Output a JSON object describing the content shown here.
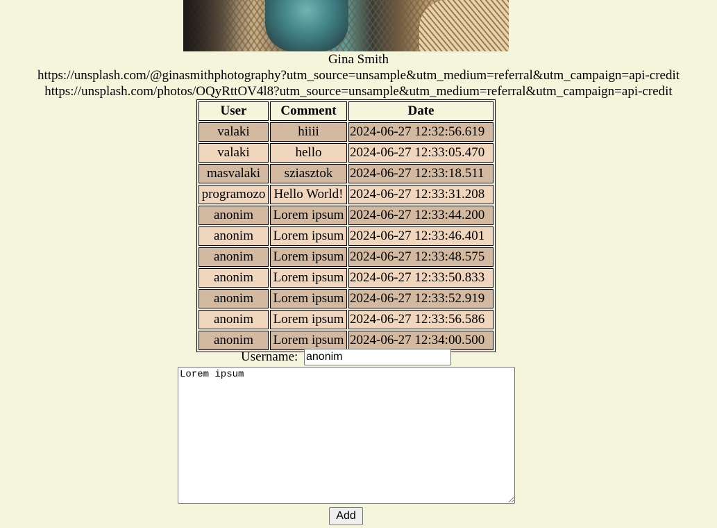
{
  "photo": {
    "alt": "photo of a woman seated in a wicker chair"
  },
  "credits": {
    "author": "Gina Smith",
    "author_url": "https://unsplash.com/@ginasmithphotography?utm_source=unsample&utm_medium=referral&utm_campaign=api-credit",
    "photo_url": "https://unsplash.com/photos/OQyRttOV4l8?utm_source=unsample&utm_medium=referral&utm_campaign=api-credit"
  },
  "table": {
    "headers": [
      "User",
      "Comment",
      "Date"
    ],
    "rows": [
      {
        "user": "valaki",
        "comment": "hiiii",
        "date": "2024-06-27 12:32:56.619"
      },
      {
        "user": "valaki",
        "comment": "hello",
        "date": "2024-06-27 12:33:05.470"
      },
      {
        "user": "masvalaki",
        "comment": "sziasztok",
        "date": "2024-06-27 12:33:18.511"
      },
      {
        "user": "programozo",
        "comment": "Hello World!",
        "date": "2024-06-27 12:33:31.208"
      },
      {
        "user": "anonim",
        "comment": "Lorem ipsum",
        "date": "2024-06-27 12:33:44.200"
      },
      {
        "user": "anonim",
        "comment": "Lorem ipsum",
        "date": "2024-06-27 12:33:46.401"
      },
      {
        "user": "anonim",
        "comment": "Lorem ipsum",
        "date": "2024-06-27 12:33:48.575"
      },
      {
        "user": "anonim",
        "comment": "Lorem ipsum",
        "date": "2024-06-27 12:33:50.833"
      },
      {
        "user": "anonim",
        "comment": "Lorem ipsum",
        "date": "2024-06-27 12:33:52.919"
      },
      {
        "user": "anonim",
        "comment": "Lorem ipsum",
        "date": "2024-06-27 12:33:56.586"
      },
      {
        "user": "anonim",
        "comment": "Lorem ipsum",
        "date": "2024-06-27 12:34:00.500"
      }
    ]
  },
  "form": {
    "username_label": "Username:",
    "username_value": "anonim",
    "comment_value": "Lorem ipsum",
    "add_label": "Add"
  },
  "colors": {
    "page_background": "#f5f5dc",
    "row_even": "#d2b9a0",
    "row_odd": "#f0d6bc"
  }
}
